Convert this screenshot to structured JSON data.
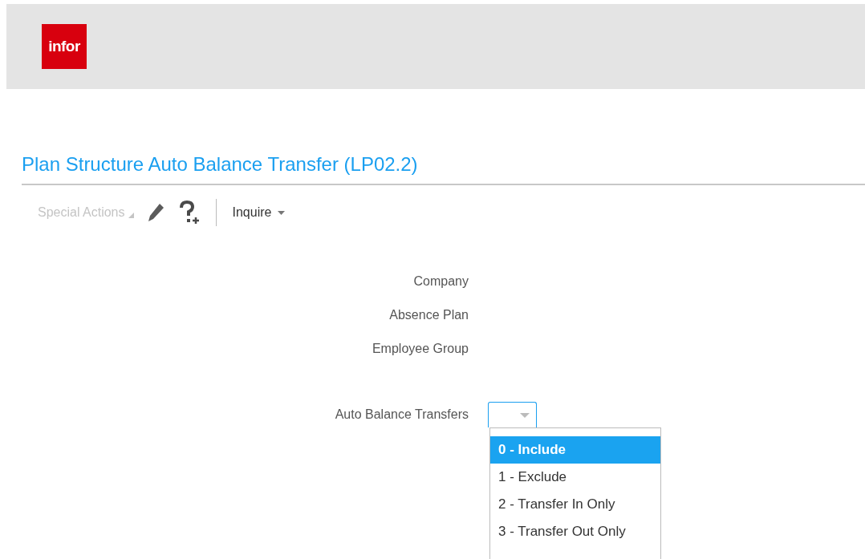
{
  "header": {
    "logo": "infor"
  },
  "page_title": "Plan Structure Auto Balance Transfer (LP02.2)",
  "toolbar": {
    "special_actions": {
      "label": "Special Actions",
      "disabled": true
    },
    "inquire": {
      "label": "Inquire"
    }
  },
  "form": {
    "fields": [
      {
        "label": "Company"
      },
      {
        "label": "Absence Plan"
      },
      {
        "label": "Employee Group"
      }
    ],
    "auto_balance": {
      "label": "Auto Balance Transfers",
      "expanded": true,
      "options": [
        {
          "label": "0 - Include",
          "selected": true
        },
        {
          "label": "1 - Exclude",
          "selected": false
        },
        {
          "label": "2 - Transfer In Only",
          "selected": false
        },
        {
          "label": "3 - Transfer Out Only",
          "selected": false
        }
      ]
    }
  }
}
